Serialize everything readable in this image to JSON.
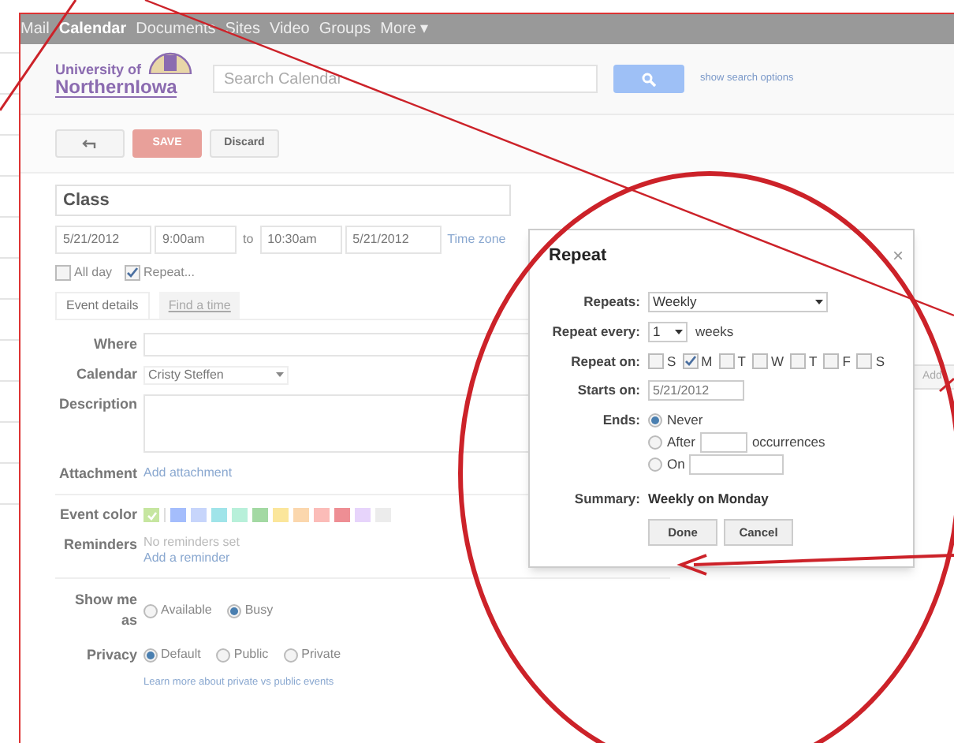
{
  "nav": [
    {
      "label": "Mail",
      "selected": false
    },
    {
      "label": "Calendar",
      "selected": true
    },
    {
      "label": "Documents",
      "selected": false
    },
    {
      "label": "Sites",
      "selected": false
    },
    {
      "label": "Video",
      "selected": false
    },
    {
      "label": "Groups",
      "selected": false
    },
    {
      "label": "More ▾",
      "selected": false
    }
  ],
  "logo": {
    "line1": "University of",
    "line2": "NorthernIowa"
  },
  "search": {
    "placeholder": "Search Calendar",
    "options_link": "show search options"
  },
  "toolbar": {
    "save": "SAVE",
    "discard": "Discard"
  },
  "event": {
    "title": "Class",
    "start_date": "5/21/2012",
    "start_time": "9:00am",
    "to": "to",
    "end_time": "10:30am",
    "end_date": "5/21/2012",
    "timezone": "Time zone"
  },
  "options": [
    {
      "label": "All day",
      "checked": false
    },
    {
      "label": "Repeat...",
      "checked": true
    }
  ],
  "tabs": [
    {
      "label": "Event details",
      "selected": true
    },
    {
      "label": "Find a time",
      "selected": false
    }
  ],
  "details": {
    "where_label": "Where",
    "calendar_label": "Calendar",
    "calendar_value": "Cristy Steffen",
    "description_label": "Description",
    "attachment_label": "Attachment",
    "attachment_link": "Add attachment",
    "color_label": "Event color",
    "reminders_label": "Reminders",
    "reminders_none": "No reminders set",
    "reminders_link": "Add a reminder",
    "showme_label": "Show me as",
    "privacy_label": "Privacy",
    "privacy_link": "Learn more about private vs public events"
  },
  "colors": [
    {
      "color": "#c6e6a0",
      "selected": true
    },
    {
      "color": "#a4bdfc",
      "selected": false
    },
    {
      "color": "#c7d5fb",
      "selected": false
    },
    {
      "color": "#a0e4e9",
      "selected": false
    },
    {
      "color": "#b8f0da",
      "selected": false
    },
    {
      "color": "#a3d9a3",
      "selected": false
    },
    {
      "color": "#fbe69b",
      "selected": false
    },
    {
      "color": "#fbd7ad",
      "selected": false
    },
    {
      "color": "#fbbcb8",
      "selected": false
    },
    {
      "color": "#ee8e94",
      "selected": false
    },
    {
      "color": "#e7d4fb",
      "selected": false
    },
    {
      "color": "#ececec",
      "selected": false
    }
  ],
  "show_me_as": [
    {
      "label": "Available",
      "selected": false
    },
    {
      "label": "Busy",
      "selected": true
    }
  ],
  "privacy": [
    {
      "label": "Default",
      "selected": true
    },
    {
      "label": "Public",
      "selected": false
    },
    {
      "label": "Private",
      "selected": false
    }
  ],
  "side_button": "Add",
  "dialog": {
    "title": "Repeat",
    "close": "×",
    "repeats_label": "Repeats:",
    "repeats_value": "Weekly",
    "every_label": "Repeat every:",
    "every_value": "1",
    "every_unit": "weeks",
    "on_label": "Repeat on:",
    "starts_label": "Starts on:",
    "starts_value": "5/21/2012",
    "ends_label": "Ends:",
    "occurrences": "occurrences",
    "summary_label": "Summary:",
    "summary_value": "Weekly on Monday",
    "done": "Done",
    "cancel": "Cancel"
  },
  "days": [
    {
      "label": "S",
      "checked": false
    },
    {
      "label": "M",
      "checked": true
    },
    {
      "label": "T",
      "checked": false
    },
    {
      "label": "W",
      "checked": false
    },
    {
      "label": "T",
      "checked": false
    },
    {
      "label": "F",
      "checked": false
    },
    {
      "label": "S",
      "checked": false
    }
  ],
  "ends": [
    {
      "label": "Never",
      "selected": true,
      "kind": "plain"
    },
    {
      "label": "After",
      "selected": false,
      "kind": "count"
    },
    {
      "label": "On",
      "selected": false,
      "kind": "date"
    }
  ]
}
